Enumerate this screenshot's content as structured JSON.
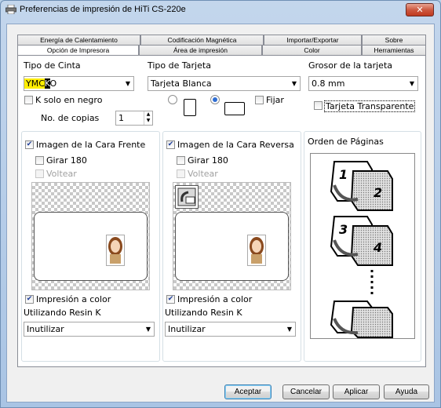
{
  "window": {
    "title": "Preferencias de impresión de HiTi CS-220e",
    "close_label": "✕"
  },
  "tabs": {
    "back_row": [
      "Energía de Calentamiento",
      "Codificación Magnética",
      "Importar/Exportar",
      "Sobre"
    ],
    "front_row": [
      "Opción de Impresora",
      "Área de impresión",
      "Color",
      "Herramientas"
    ],
    "active": "Opción de Impresora"
  },
  "ribbon": {
    "label": "Tipo de Cinta",
    "value": "YMCKO",
    "ymc_text": "YMC",
    "k_text": "K",
    "o_text": "O"
  },
  "card_type": {
    "label": "Tipo de Tarjeta",
    "value": "Tarjeta Blanca"
  },
  "card_thickness": {
    "label": "Grosor de la tarjeta",
    "value": "0.8 mm"
  },
  "k_black_only": {
    "label": "K solo en negro",
    "checked": false
  },
  "copies": {
    "label": "No. de copias",
    "value": "1"
  },
  "orientation": {
    "fix_label": "Fijar",
    "selected": "landscape"
  },
  "transparent_card": {
    "label": "Tarjeta Transparente",
    "checked": false
  },
  "front": {
    "title": "Imagen de la Cara Frente",
    "rotate": "Girar 180",
    "flip": "Voltear",
    "color_print": "Impresión a color",
    "resin_label": "Utilizando Resin K",
    "resin_value": "Inutilizar"
  },
  "back": {
    "title": "Imagen de la Cara Reversa",
    "rotate": "Girar 180",
    "flip": "Voltear",
    "color_print": "Impresión a color",
    "resin_label": "Utilizando Resin K",
    "resin_value": "Inutilizar"
  },
  "page_order": {
    "title": "Orden de Páginas",
    "pages": [
      "1",
      "2",
      "3",
      "4"
    ]
  },
  "buttons": {
    "accept": "Aceptar",
    "cancel": "Cancelar",
    "apply": "Aplicar",
    "help": "Ayuda"
  }
}
